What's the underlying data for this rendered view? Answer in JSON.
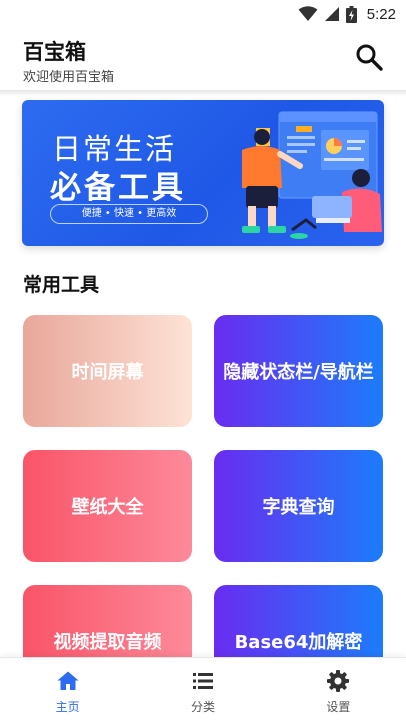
{
  "status_bar": {
    "time": "5:22",
    "icons": [
      "wifi-icon",
      "signal-icon",
      "battery-icon"
    ]
  },
  "header": {
    "title": "百宝箱",
    "subtitle": "欢迎使用百宝箱",
    "search_icon": "search-icon"
  },
  "banner": {
    "line1": "日常生活",
    "line2": "必备工具",
    "tagline": "便捷 • 快速 • 更高效"
  },
  "section": {
    "title": "常用工具"
  },
  "tools": [
    {
      "label": "时间屏幕"
    },
    {
      "label": "隐藏状态栏/导航栏"
    },
    {
      "label": "壁纸大全"
    },
    {
      "label": "字典查询"
    },
    {
      "label": "视频提取音频"
    },
    {
      "label": "Base64加解密"
    }
  ],
  "nav": {
    "items": [
      {
        "label": "主页",
        "icon": "home-icon",
        "active": true
      },
      {
        "label": "分类",
        "icon": "list-icon",
        "active": false
      },
      {
        "label": "设置",
        "icon": "gear-icon",
        "active": false
      }
    ]
  },
  "colors": {
    "accent": "#2d6cf0",
    "card_red": "#fa5468",
    "card_blue": "#1c7cfb",
    "card_purple": "#6a2cf0"
  }
}
